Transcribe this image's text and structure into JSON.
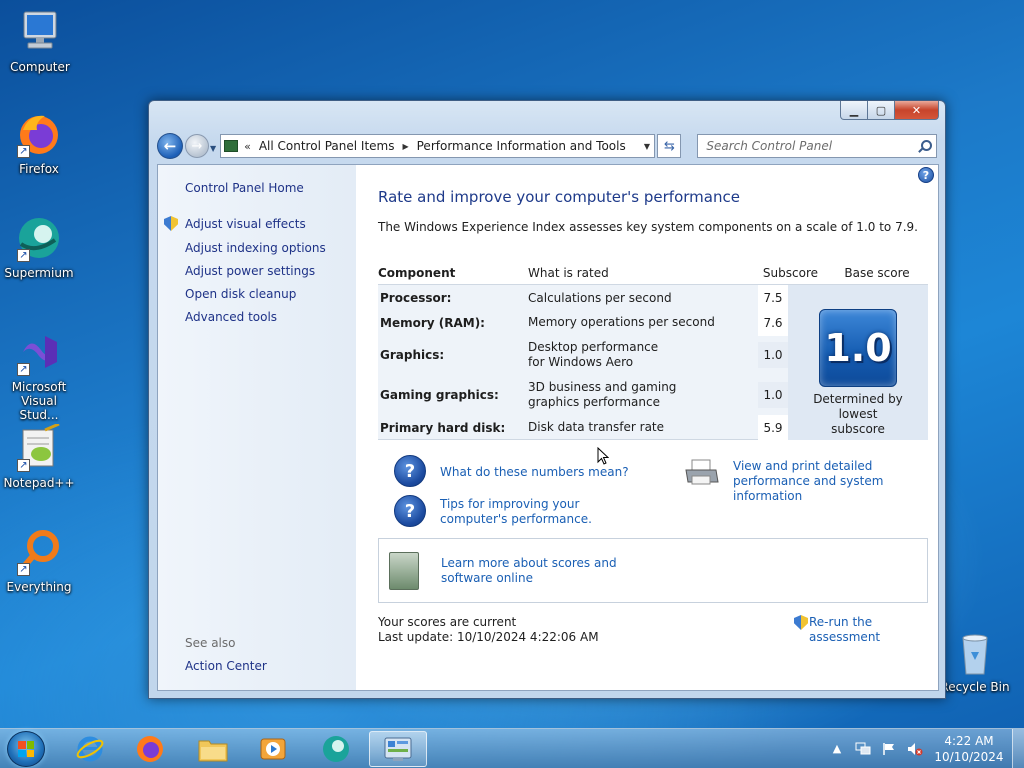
{
  "desktop": {
    "icons": [
      {
        "label": "Computer"
      },
      {
        "label": "Firefox"
      },
      {
        "label": "Supermium"
      },
      {
        "label": "Microsoft Visual Stud..."
      },
      {
        "label": "Notepad++"
      },
      {
        "label": "Everything"
      },
      {
        "label": "Recycle Bin"
      }
    ]
  },
  "window": {
    "address": {
      "chevron": "«",
      "segments": [
        "All Control Panel Items",
        "Performance Information and Tools"
      ]
    },
    "search": {
      "placeholder": "Search Control Panel"
    },
    "sidebar": {
      "home": "Control Panel Home",
      "links": [
        "Adjust visual effects",
        "Adjust indexing options",
        "Adjust power settings",
        "Open disk cleanup",
        "Advanced tools"
      ],
      "see_also": "See also",
      "see_also_links": [
        "Action Center"
      ]
    },
    "main": {
      "title": "Rate and improve your computer's performance",
      "intro": "The Windows Experience Index assesses key system components on a scale of 1.0 to 7.9.",
      "table": {
        "headers": {
          "component": "Component",
          "what": "What is rated",
          "subscore": "Subscore",
          "base": "Base score"
        },
        "rows": [
          {
            "component": "Processor:",
            "what": "Calculations per second",
            "subscore": "7.5"
          },
          {
            "component": "Memory (RAM):",
            "what": "Memory operations per second",
            "subscore": "7.6"
          },
          {
            "component": "Graphics:",
            "what": "Desktop performance for Windows Aero",
            "subscore": "1.0"
          },
          {
            "component": "Gaming graphics:",
            "what": "3D business and gaming graphics performance",
            "subscore": "1.0"
          },
          {
            "component": "Primary hard disk:",
            "what": "Disk data transfer rate",
            "subscore": "5.9"
          }
        ],
        "base_score": "1.0",
        "base_caption": "Determined by lowest subscore"
      },
      "links": {
        "what_numbers": "What do these numbers mean?",
        "view_print": "View and print detailed performance and system information",
        "tips": "Tips for improving your computer's performance.",
        "learn_more": "Learn more about scores and software online",
        "rerun": "Re-run the assessment"
      },
      "status": {
        "current": "Your scores are current",
        "last_update": "Last update: 10/10/2024 4:22:06 AM"
      }
    }
  },
  "taskbar": {
    "clock_time": "4:22 AM",
    "clock_date": "10/10/2024"
  }
}
